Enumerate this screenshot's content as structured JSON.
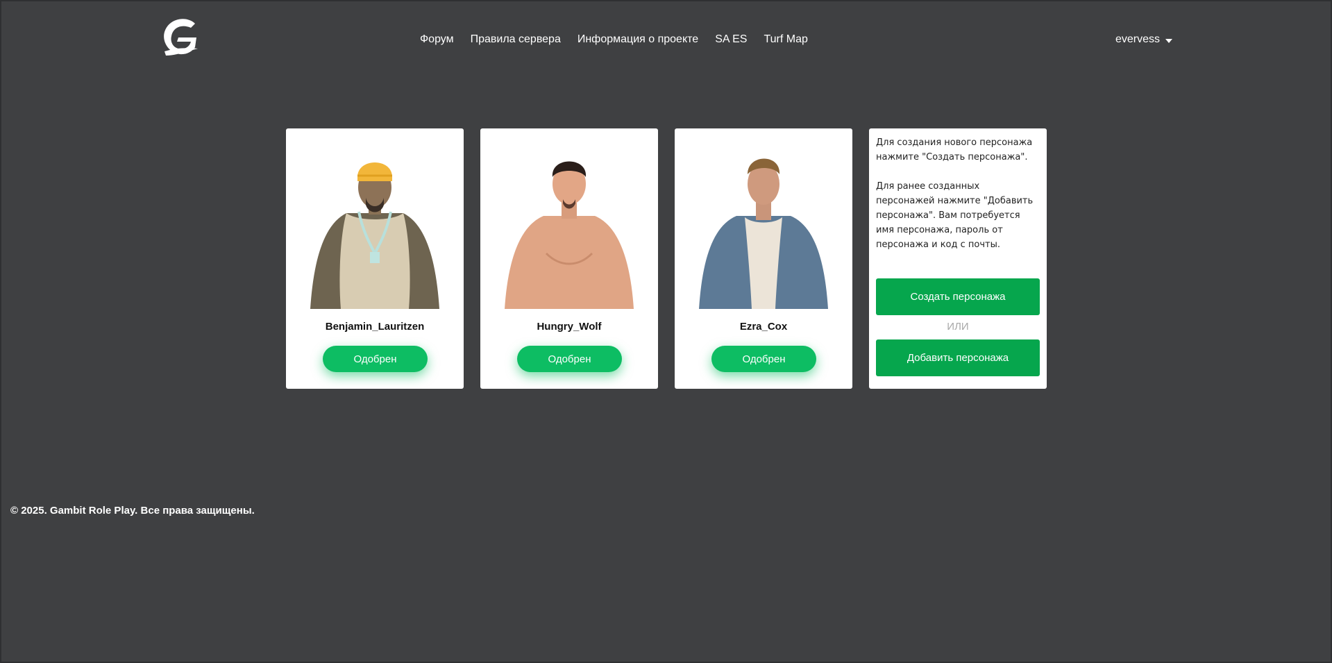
{
  "header": {
    "logo_icon": "gambit-g-logo-icon",
    "nav": [
      {
        "label": "Форум"
      },
      {
        "label": "Правила сервера"
      },
      {
        "label": "Информация о проекте"
      },
      {
        "label": "SA ES"
      },
      {
        "label": "Turf Map"
      }
    ],
    "user": {
      "name": "evervess",
      "icon": "caret-down-icon"
    }
  },
  "characters": [
    {
      "name": "Benjamin_Lauritzen",
      "status": "Одобрен",
      "portrait": "bandana-man-portrait"
    },
    {
      "name": "Hungry_Wolf",
      "status": "Одобрен",
      "portrait": "shirtless-man-portrait"
    },
    {
      "name": "Ezra_Cox",
      "status": "Одобрен",
      "portrait": "denim-vest-man-portrait"
    }
  ],
  "info_card": {
    "text_create": "Для создания нового персонажа нажмите \"Создать персонажа\".",
    "text_add": "Для ранее созданных персонажей нажмите \"Добавить персонажа\". Вам потребуется имя персонажа, пароль от персонажа и код с почты.",
    "create_button": "Создать персонажа",
    "or_label": "ИЛИ",
    "add_button": "Добавить персонажа"
  },
  "footer": {
    "copyright": "© 2025. Gambit Role Play. Все права защищены."
  },
  "colors": {
    "background": "#3f4042",
    "status_green": "#0dbd63",
    "action_green": "#06a64d"
  }
}
